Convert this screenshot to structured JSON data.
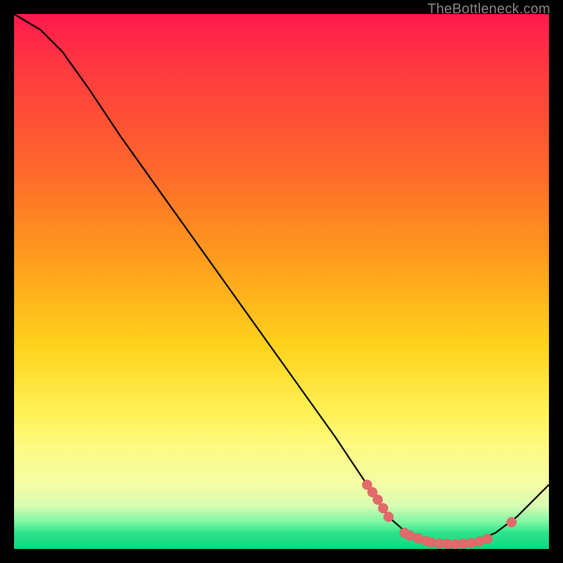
{
  "attribution": "TheBottleneck.com",
  "chart_data": {
    "type": "line",
    "title": "",
    "xlabel": "",
    "ylabel": "",
    "xlim": [
      0,
      100
    ],
    "ylim": [
      0,
      100
    ],
    "curve": [
      {
        "x": 0,
        "y": 100
      },
      {
        "x": 5,
        "y": 97
      },
      {
        "x": 9,
        "y": 93
      },
      {
        "x": 14,
        "y": 86
      },
      {
        "x": 20,
        "y": 77
      },
      {
        "x": 30,
        "y": 63
      },
      {
        "x": 40,
        "y": 49
      },
      {
        "x": 50,
        "y": 35
      },
      {
        "x": 60,
        "y": 21
      },
      {
        "x": 66,
        "y": 12
      },
      {
        "x": 70,
        "y": 6
      },
      {
        "x": 74,
        "y": 2.5
      },
      {
        "x": 78,
        "y": 1.2
      },
      {
        "x": 82,
        "y": 0.9
      },
      {
        "x": 86,
        "y": 1.3
      },
      {
        "x": 90,
        "y": 3
      },
      {
        "x": 94,
        "y": 6
      },
      {
        "x": 100,
        "y": 12
      }
    ],
    "markers": [
      {
        "x": 66,
        "y": 12
      },
      {
        "x": 67,
        "y": 10.6
      },
      {
        "x": 68,
        "y": 9.2
      },
      {
        "x": 69,
        "y": 7.6
      },
      {
        "x": 70,
        "y": 6
      },
      {
        "x": 73,
        "y": 3
      },
      {
        "x": 74,
        "y": 2.5
      },
      {
        "x": 75.5,
        "y": 2
      },
      {
        "x": 77,
        "y": 1.5
      },
      {
        "x": 78,
        "y": 1.2
      },
      {
        "x": 79.5,
        "y": 1.0
      },
      {
        "x": 81,
        "y": 0.95
      },
      {
        "x": 82.5,
        "y": 0.9
      },
      {
        "x": 84,
        "y": 1.0
      },
      {
        "x": 85.5,
        "y": 1.1
      },
      {
        "x": 87,
        "y": 1.4
      },
      {
        "x": 88.5,
        "y": 1.9
      },
      {
        "x": 93,
        "y": 5
      }
    ],
    "gradient_stops": [
      {
        "pos": 0,
        "color": "#ff1a4d"
      },
      {
        "pos": 12,
        "color": "#ff3e3e"
      },
      {
        "pos": 30,
        "color": "#ff6a2a"
      },
      {
        "pos": 45,
        "color": "#ff9a1e"
      },
      {
        "pos": 62,
        "color": "#ffd21a"
      },
      {
        "pos": 75,
        "color": "#fff35a"
      },
      {
        "pos": 83,
        "color": "#fbfc8e"
      },
      {
        "pos": 88,
        "color": "#f4fca6"
      },
      {
        "pos": 92,
        "color": "#d8fcb4"
      },
      {
        "pos": 95,
        "color": "#7df7a2"
      },
      {
        "pos": 97,
        "color": "#2be48a"
      },
      {
        "pos": 100,
        "color": "#0fd880"
      }
    ]
  }
}
